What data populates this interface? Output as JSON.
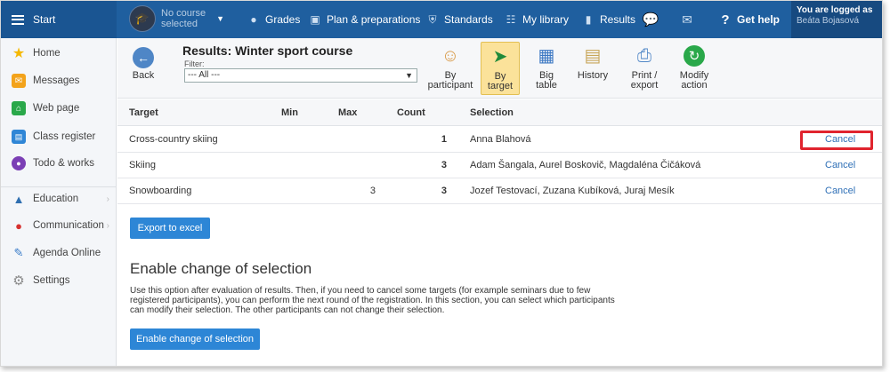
{
  "topbar": {
    "start_label": "Start",
    "course": {
      "line1": "No course",
      "line2": "selected"
    },
    "nav": [
      {
        "label": "Grades",
        "icon": "palette-icon"
      },
      {
        "label": "Plan & preparations",
        "icon": "briefcase-icon"
      },
      {
        "label": "Standards",
        "icon": "shield-icon"
      },
      {
        "label": "My library",
        "icon": "library-icon"
      },
      {
        "label": "Results",
        "icon": "bar-chart-icon"
      }
    ],
    "help_label": "Get help",
    "logged": {
      "line1": "You are logged as",
      "line2": "Beáta Bojasová"
    }
  },
  "sidebar": {
    "items": [
      {
        "label": "Home",
        "icon": "star-icon"
      },
      {
        "label": "Messages",
        "icon": "envelope-icon"
      },
      {
        "label": "Web page",
        "icon": "house-icon"
      },
      {
        "label": "Class register",
        "icon": "register-icon"
      },
      {
        "label": "Todo & works",
        "icon": "todo-icon"
      },
      {
        "label": "Education",
        "icon": "education-icon"
      },
      {
        "label": "Communication",
        "icon": "communication-icon"
      },
      {
        "label": "Agenda Online",
        "icon": "pencil-icon"
      },
      {
        "label": "Settings",
        "icon": "gear-icon"
      }
    ]
  },
  "toolbar": {
    "back_label": "Back",
    "title": "Results: Winter sport course",
    "filter_label": "Filter:",
    "filter_value": "--- All ---",
    "buttons": [
      {
        "line1": "By",
        "line2": "participant",
        "icon": "person-icon"
      },
      {
        "line1": "By",
        "line2": "target",
        "icon": "target-icon"
      },
      {
        "line1": "Big",
        "line2": "table",
        "icon": "table-icon"
      },
      {
        "line1": "History",
        "line2": "",
        "icon": "scroll-icon"
      },
      {
        "line1": "Print /",
        "line2": "export",
        "icon": "printer-icon"
      },
      {
        "line1": "Modify",
        "line2": "action",
        "icon": "refresh-icon"
      }
    ]
  },
  "table": {
    "headers": {
      "target": "Target",
      "min": "Min",
      "max": "Max",
      "count": "Count",
      "selection": "Selection"
    },
    "rows": [
      {
        "target": "Cross-country skiing",
        "min": "",
        "max": "",
        "count": "1",
        "selection": "Anna Blahová",
        "action": "Cancel"
      },
      {
        "target": "Skiing",
        "min": "",
        "max": "",
        "count": "3",
        "selection": "Adam Šangala, Aurel Boskovič, Magdaléna Čičáková",
        "action": "Cancel"
      },
      {
        "target": "Snowboarding",
        "min": "",
        "max": "3",
        "count": "3",
        "selection": "Jozef Testovací, Zuzana Kubíková, Juraj Mesík",
        "action": "Cancel"
      }
    ]
  },
  "export_label": "Export to excel",
  "section": {
    "title": "Enable change of selection",
    "text": "Use this option after evaluation of results. Then, if you need to cancel some targets (for example seminars due to few registered participants), you can perform the next round of the registration. In this section, you can select which participants can modify their selection. The other participants can not change their selection.",
    "button_label": "Enable change of selection"
  },
  "colors": {
    "topbar": "#1f5f9f",
    "accent_button": "#2d86d6",
    "highlight_box": "#e0242e",
    "active_tool": "#fbe29a"
  }
}
